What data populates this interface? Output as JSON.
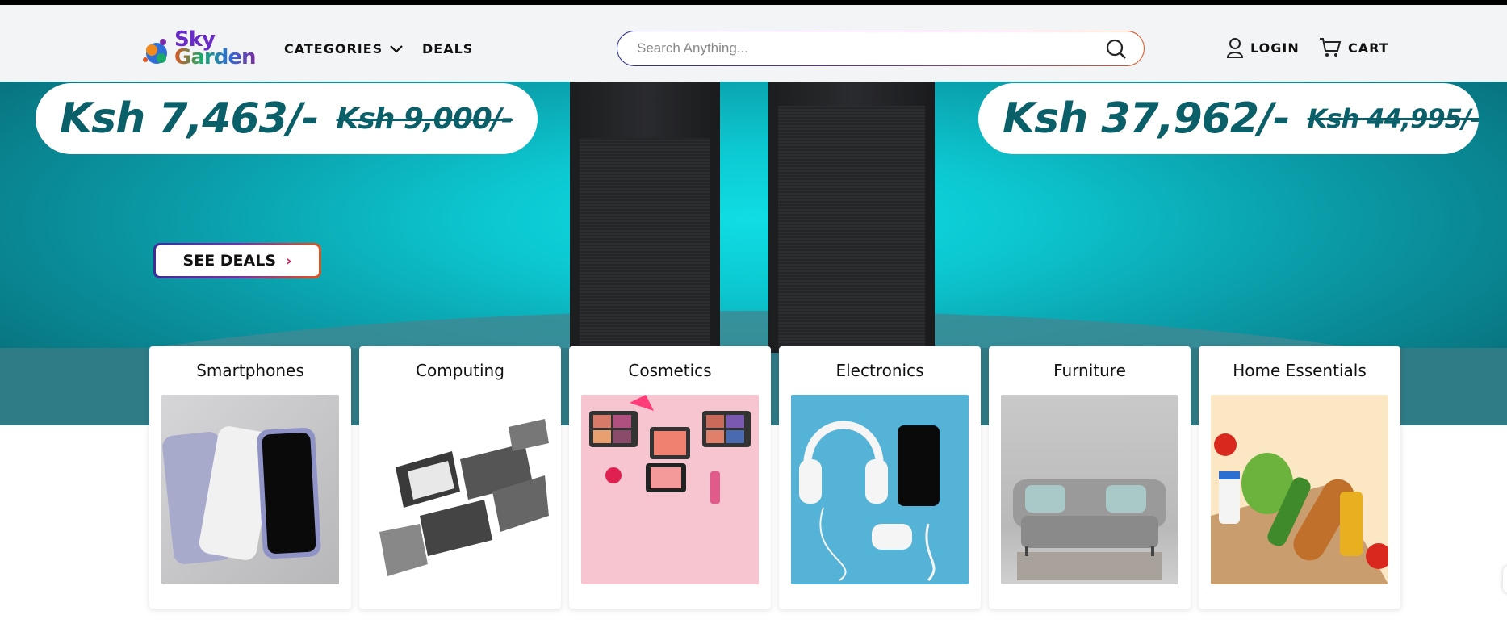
{
  "brand": {
    "line1": "Sky",
    "line2": "Garden"
  },
  "nav": {
    "categories": "CATEGORIES",
    "deals": "DEALS"
  },
  "search": {
    "placeholder": "Search Anything..."
  },
  "account": {
    "login": "LOGIN",
    "cart": "CART"
  },
  "hero": {
    "left_price": "Ksh 7,463/-",
    "left_old_price": "Ksh 9,000/-",
    "right_price": "Ksh 37,962/-",
    "right_old_price": "Ksh 44,995/-",
    "cta": "SEE DEALS",
    "cta_chevron": "›"
  },
  "categories": [
    {
      "title": "Smartphones"
    },
    {
      "title": "Computing"
    },
    {
      "title": "Cosmetics"
    },
    {
      "title": "Electronics"
    },
    {
      "title": "Furniture"
    },
    {
      "title": "Home Essentials"
    }
  ],
  "colors": {
    "teal": "#0a9aa6",
    "price": "#0b5f68",
    "brand_purple": "#6a2cc9",
    "accent_orange": "#e2541f"
  }
}
